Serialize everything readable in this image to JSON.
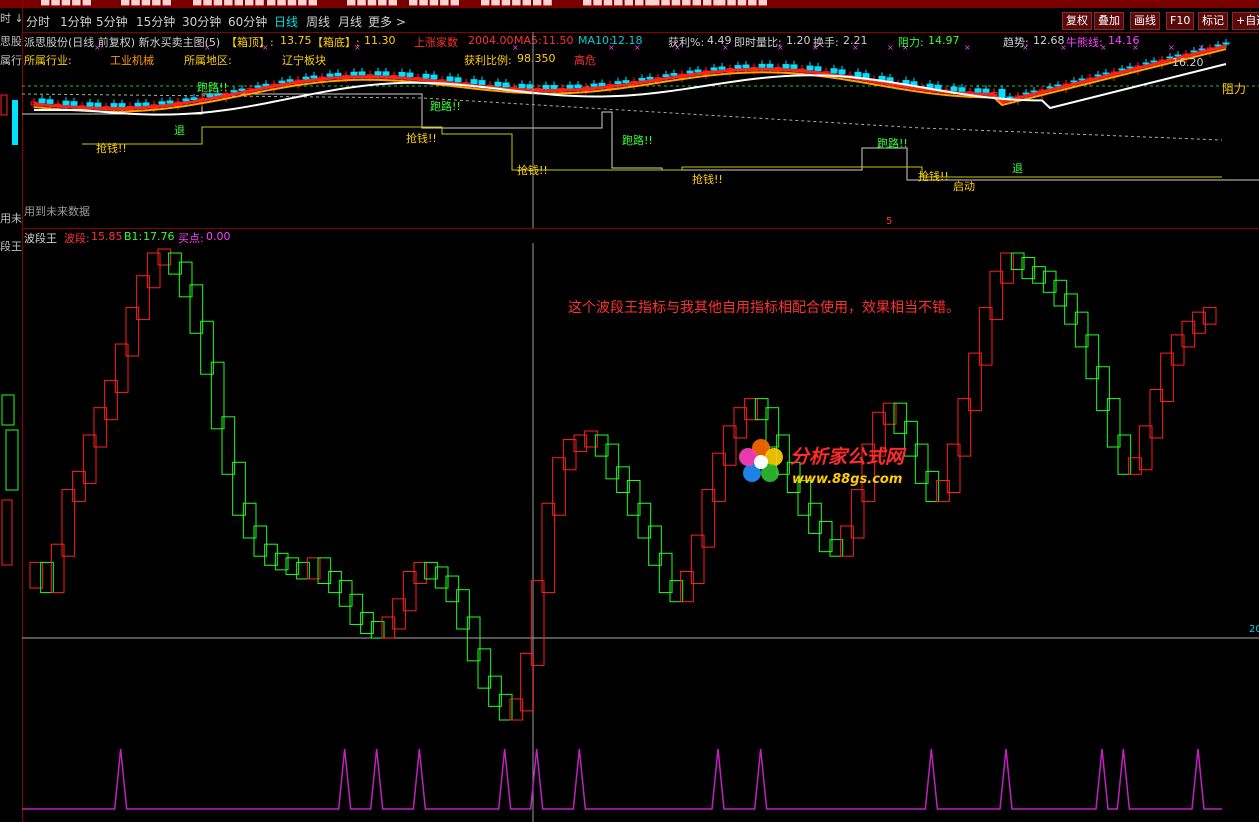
{
  "menubar": {
    "items": [
      "■■■■■",
      "■■■■■",
      "■■■■■■■",
      "■■■■■",
      "■■■■■",
      "■■■■■",
      "■■■■■■■",
      "■■■■■■■",
      "■■■■■■■",
      "■■■■■"
    ]
  },
  "periods": [
    "分时",
    "1分钟",
    "5分钟",
    "15分钟",
    "30分钟",
    "60分钟",
    "日线",
    "周线",
    "月线",
    "更多 >"
  ],
  "active_period": "日线",
  "tools": [
    "复权",
    "叠加",
    "画线",
    "F10",
    "标记",
    "+自选"
  ],
  "left_strip": {
    "texts": [
      "时 ↓",
      "思股份",
      "属行业",
      "用未来",
      "段王"
    ]
  },
  "chart_header": {
    "title": "派思股份(日线 前复权) 新水买卖主图(5)",
    "box_top_label": "【箱顶】:",
    "box_top": "13.75",
    "box_bottom_label": "【箱底】:",
    "box_bottom": "11.30",
    "master_label": "上涨家数",
    "master_value": "2004.00",
    "ma5_label": "MA5:",
    "ma5": "11.50",
    "ma10_label": "MA10:",
    "ma10": "12.18",
    "profit_pct_label": "获利%:",
    "profit_pct": "4.49",
    "volratio_label": "即时量比:",
    "volratio": "1.20",
    "turnover_label": "换手:",
    "turnover": "2.21",
    "resist_label": "阻力:",
    "resist": "14.97",
    "trend_label": "趋势:",
    "trend": "12.68",
    "bull_label": "牛熊线:",
    "bull": "14.16"
  },
  "chart_header2": {
    "industry_label": "所属行业:",
    "industry": "工业机械",
    "region_label": "所属地区:",
    "region": "辽宁板块",
    "profit_ratio_label": "获利比例:",
    "profit_ratio": "98.350",
    "risk": "高危"
  },
  "price_labels": {
    "high": "16.20",
    "resistance": "阻力"
  },
  "future_note": "用到未来数据",
  "signals": {
    "pullback": "抢钱!!",
    "run": "跑路!!",
    "retreat": "退",
    "start": "启动",
    "bottom_mark": "5"
  },
  "wave_header": {
    "name": "波段王",
    "wave_label": "波段:",
    "wave": "15.85",
    "b1_label": "B1:",
    "b1": "17.76",
    "buy_label": "买点:",
    "buy": "0.00"
  },
  "comment": "这个波段王指标与我其他自用指标相配合使用，效果相当不错。",
  "watermark": {
    "name": "分析家公式网",
    "url": "www.88gs.com"
  },
  "right_axis_label": "20",
  "colors": {
    "up": "#ff2020",
    "down": "#20ff20",
    "ma_fast": "#ffa000",
    "ma_slow": "#ffffff",
    "box": "#c8c800",
    "buy_spike": "#c020c0"
  },
  "wave_series": [
    0.32,
    0.28,
    0.36,
    0.48,
    0.52,
    0.6,
    0.66,
    0.72,
    0.8,
    0.88,
    0.95,
    1.0,
    1.0,
    0.98,
    0.93,
    0.85,
    0.76,
    0.64,
    0.54,
    0.45,
    0.4,
    0.36,
    0.34,
    0.33,
    0.32,
    0.31,
    0.33,
    0.3,
    0.28,
    0.25,
    0.21,
    0.19,
    0.18,
    0.2,
    0.24,
    0.3,
    0.32,
    0.31,
    0.29,
    0.26,
    0.2,
    0.13,
    0.07,
    0.03,
    0.0,
    0.02,
    0.12,
    0.28,
    0.45,
    0.55,
    0.59,
    0.6,
    0.6,
    0.58,
    0.53,
    0.5,
    0.45,
    0.4,
    0.34,
    0.28,
    0.26,
    0.3,
    0.38,
    0.48,
    0.56,
    0.62,
    0.66,
    0.68,
    0.66,
    0.6,
    0.54,
    0.5,
    0.45,
    0.41,
    0.37,
    0.36,
    0.4,
    0.48,
    0.58,
    0.65,
    0.67,
    0.63,
    0.58,
    0.52,
    0.48,
    0.5,
    0.58,
    0.68,
    0.78,
    0.88,
    0.96,
    1.0,
    0.99,
    0.97,
    0.96,
    0.94,
    0.91,
    0.87,
    0.82,
    0.75,
    0.68,
    0.6,
    0.54,
    0.55,
    0.62,
    0.7,
    0.78,
    0.82,
    0.85,
    0.87,
    0.88
  ],
  "buy_spikes": [
    8,
    29,
    32,
    36,
    44,
    47,
    51,
    64,
    68,
    84,
    91,
    100,
    102,
    109
  ]
}
